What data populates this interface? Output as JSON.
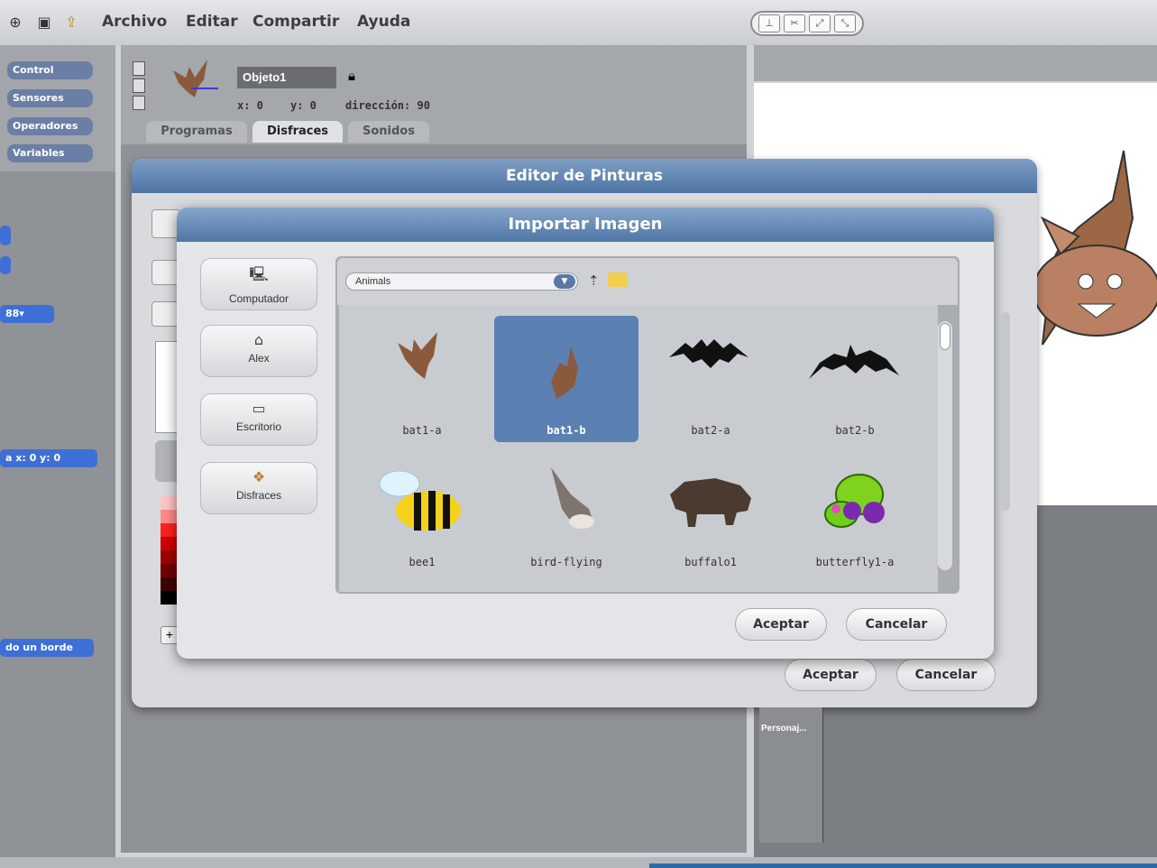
{
  "menu": {
    "items": [
      "Archivo",
      "Editar",
      "Compartir",
      "Ayuda"
    ]
  },
  "palette": {
    "categories": [
      "Control",
      "Sensores",
      "Operadores",
      "Variables"
    ],
    "blocks": {
      "dropdown_value": "88▾",
      "goto_block": "a x: 0 y: 0",
      "edge_block": "do un borde"
    }
  },
  "sprite": {
    "name": "Objeto1",
    "x_label": "x: 0",
    "y_label": "y: 0",
    "direction_label": "dirección: 90"
  },
  "tabs": [
    "Programas",
    "Disfraces",
    "Sonidos"
  ],
  "paint_editor": {
    "title": "Editor de Pinturas",
    "accept": "Aceptar",
    "cancel": "Cancelar",
    "costume_footer": "Personaj..."
  },
  "import_dialog": {
    "title": "Importar Imagen",
    "places": [
      {
        "label": "Computador",
        "icon": "computer-icon"
      },
      {
        "label": "Alex",
        "icon": "home-icon"
      },
      {
        "label": "Escritorio",
        "icon": "folder-icon"
      },
      {
        "label": "Disfraces",
        "icon": "costumes-icon"
      }
    ],
    "folder": "Animals",
    "files": [
      "bat1-a",
      "bat1-b",
      "bat2-a",
      "bat2-b",
      "bee1",
      "bird-flying",
      "buffalo1",
      "butterfly1-a"
    ],
    "selected_file": "bat1-b",
    "accept": "Aceptar",
    "cancel": "Cancelar"
  },
  "colors": {
    "title_blue": "#4d74a3",
    "selection": "#5b80b2",
    "block_blue": "#3e6fd6"
  }
}
